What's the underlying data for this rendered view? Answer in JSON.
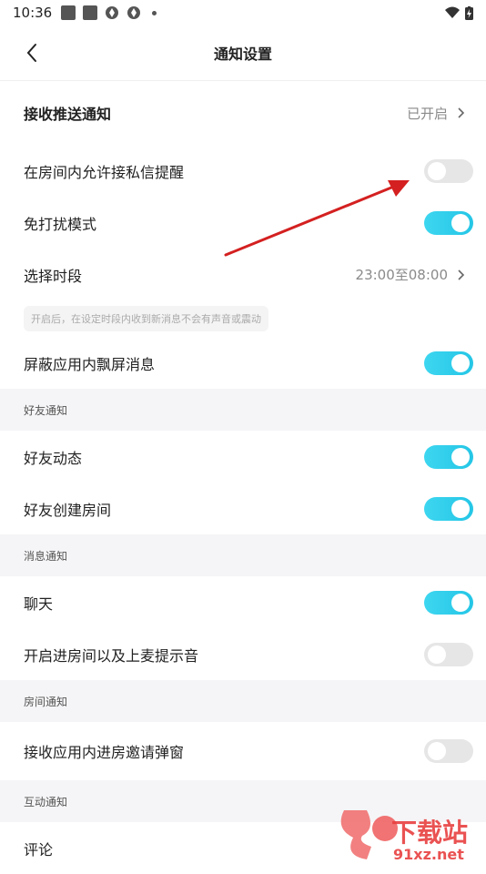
{
  "status_bar": {
    "time": "10:36"
  },
  "header": {
    "title": "通知设置"
  },
  "rows": {
    "push": {
      "label": "接收推送通知",
      "value": "已开启"
    },
    "room_private": {
      "label": "在房间内允许接私信提醒",
      "on": false
    },
    "dnd": {
      "label": "免打扰模式",
      "on": true
    },
    "period": {
      "label": "选择时段",
      "value": "23:00至08:00"
    },
    "period_hint": "开启后，在设定时段内收到新消息不会有声音或震动",
    "block_float": {
      "label": "屏蔽应用内飘屏消息",
      "on": true
    }
  },
  "sections": {
    "friends": {
      "title": "好友通知",
      "items": [
        {
          "label": "好友动态",
          "on": true
        },
        {
          "label": "好友创建房间",
          "on": true
        }
      ]
    },
    "messages": {
      "title": "消息通知",
      "items": [
        {
          "label": "聊天",
          "on": true
        },
        {
          "label": "开启进房间以及上麦提示音",
          "on": false
        }
      ]
    },
    "room": {
      "title": "房间通知",
      "items": [
        {
          "label": "接收应用内进房邀请弹窗",
          "on": false
        }
      ]
    },
    "interact": {
      "title": "互动通知",
      "items": [
        {
          "label": "评论"
        }
      ]
    }
  },
  "watermark": {
    "text": "下载站",
    "url": "91xz.net"
  },
  "colors": {
    "toggle_on": "#2ecbe9",
    "toggle_off": "#e6e6e6",
    "annotation_arrow": "#d42020"
  }
}
